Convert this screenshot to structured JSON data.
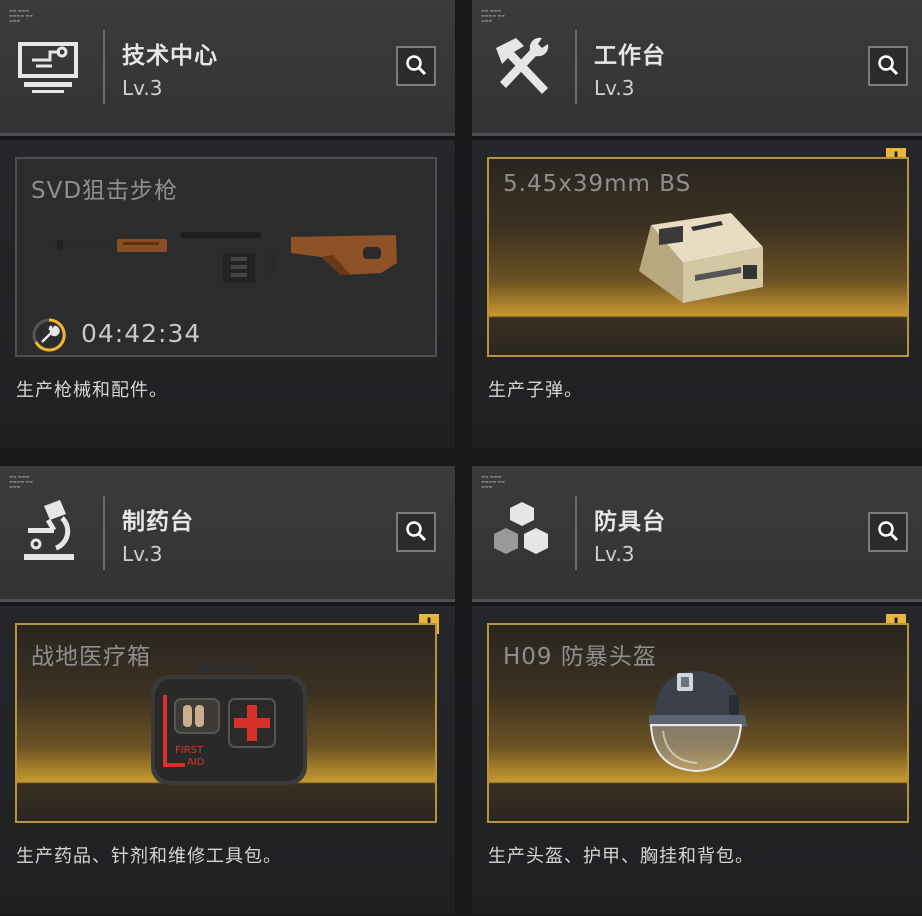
{
  "stations": [
    {
      "name": "技术中心",
      "level": "Lv.3",
      "icon": "computer-icon",
      "item_name": "SVD狙击步枪",
      "timer": "04:42:34",
      "description": "生产枪械和配件。",
      "alert": false
    },
    {
      "name": "工作台",
      "level": "Lv.3",
      "icon": "hammer-wrench-icon",
      "item_name": "5.45x39mm BS",
      "description": "生产子弹。",
      "alert": true,
      "alert_symbol": "!"
    },
    {
      "name": "制药台",
      "level": "Lv.3",
      "icon": "microscope-icon",
      "item_name": "战地医疗箱",
      "description": "生产药品、针剂和维修工具包。",
      "alert": true,
      "alert_symbol": "!"
    },
    {
      "name": "防具台",
      "level": "Lv.3",
      "icon": "cubes-icon",
      "item_name": "H09 防暴头盔",
      "description": "生产头盔、护甲、胸挂和背包。",
      "alert": true,
      "alert_symbol": "!"
    }
  ],
  "colors": {
    "accent_gold": "#e8b63a",
    "timer_ring": "#f0b62c",
    "background": "#171819"
  }
}
